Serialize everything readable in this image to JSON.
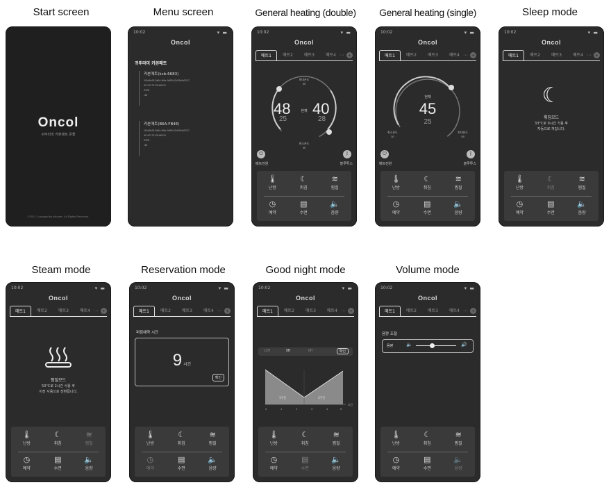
{
  "captions": {
    "start": "Start screen",
    "menu": "Menu screen",
    "heating_double": "General heating (double)",
    "heating_single": "General heating (single)",
    "sleep": "Sleep mode",
    "steam": "Steam mode",
    "reservation": "Reservation mode",
    "goodnight": "Good night mode",
    "volume": "Volume mode"
  },
  "status": {
    "time": "10:02",
    "icons": "▾ ▬"
  },
  "brand": "Oncol",
  "start": {
    "logo": "Oncol",
    "tagline": "귀뚜라미 카본매트 온돌",
    "copyright": "©2021 Copyright by kiturami. All Rights Reserved."
  },
  "tabs": [
    "매트1",
    "매트2",
    "매트3",
    "매트4"
  ],
  "tab_more": "···",
  "tab_add": "+",
  "bottom_buttons": [
    {
      "label": "난방",
      "icon": "🌡"
    },
    {
      "label": "취침",
      "icon": "☾"
    },
    {
      "label": "찜질",
      "icon": "≋"
    },
    {
      "label": "예약",
      "icon": "◷"
    },
    {
      "label": "수면",
      "icon": "▤"
    },
    {
      "label": "음량",
      "icon": "🔈"
    }
  ],
  "menu": {
    "title": "귀뚜라미 카본매트",
    "devices": [
      {
        "name": "카본매트(kcb-6683)",
        "lines": [
          "1f2a3b45-2d84-4f6a-9d55-62d2fb4b0317",
          "9C:0C:7E:2D:86:D0",
          "RSSI",
          "-56"
        ]
      },
      {
        "name": "카본매트(B6A-FB4E)",
        "lines": [
          "1f2a3b45-2d84-4f6a-9d55-62d2fb4b0317",
          "9C:0C:7E:2D:86:D0",
          "RSSI",
          "-56"
        ]
      }
    ]
  },
  "heating_double": {
    "left_temp": "48",
    "left_set": "25",
    "right_temp": "40",
    "right_set": "28",
    "top_label": "최대온도",
    "top_value": "55",
    "bottom_label": "최소온도",
    "bottom_value": "30",
    "mid_label": "현재",
    "power_label": "매트전원",
    "bt_label": "블루투스"
  },
  "heating_single": {
    "temp": "45",
    "set": "25",
    "mid_label": "현재",
    "left_label": "최소온도",
    "left_value": "30",
    "right_label": "최대온도",
    "right_value": "55",
    "power_label": "매트전원",
    "bt_label": "블루투스"
  },
  "sleep": {
    "title": "취침모드",
    "desc1": "33°C로 9시간 가동 후",
    "desc2": "자동으로 꺼집니다."
  },
  "steam": {
    "title": "찜질모드",
    "desc1": "50°C로 2시간 사용 후",
    "desc2": "이전 사용으로 전환됩니다."
  },
  "reservation": {
    "label": "퍼짐예약 시간",
    "value": "9",
    "unit": "시간",
    "confirm": "확인"
  },
  "goodnight": {
    "chips": [
      "12H",
      "9H",
      "6H",
      "확인"
    ],
    "left_seg": "1구간",
    "right_seg": "3구간",
    "ticks": [
      "0",
      "1",
      "2",
      "3",
      "4",
      "5"
    ],
    "unit": "시간"
  },
  "volume": {
    "title": "음량 조절",
    "label": "음량",
    "level": 0.4
  }
}
